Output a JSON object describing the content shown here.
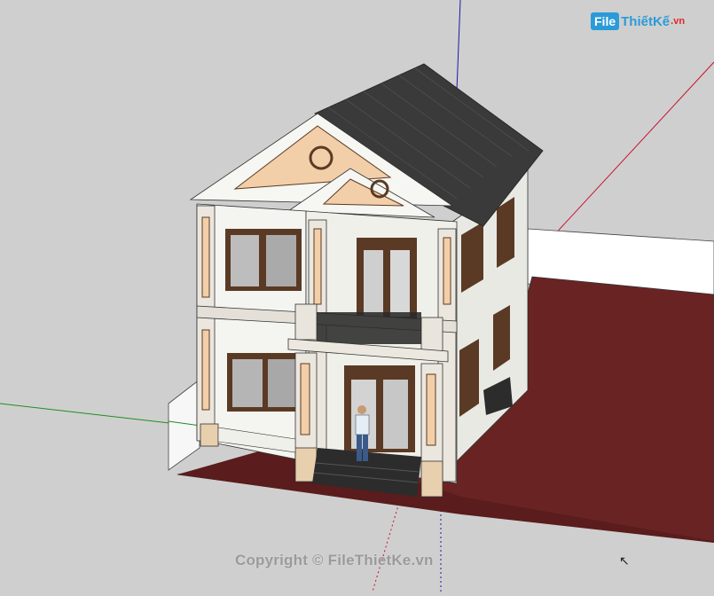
{
  "logo": {
    "box": "File",
    "text": "ThiếtKế",
    "ext": ".vn"
  },
  "watermark": {
    "copyright": "Copyright © FileThietKe.vn"
  },
  "colors": {
    "background": "#cfcfcf",
    "ground": "#6a2323",
    "roof": "#3a3a3a",
    "wall": "#f4f4f0",
    "trim_brown": "#4a2f1f",
    "gable_fill": "#f2cfa8",
    "axis_red": "#c8102e",
    "axis_green": "#1f8f1f",
    "axis_blue": "#1a1aa8"
  },
  "icons": {
    "cursor": "select-arrow-icon"
  }
}
